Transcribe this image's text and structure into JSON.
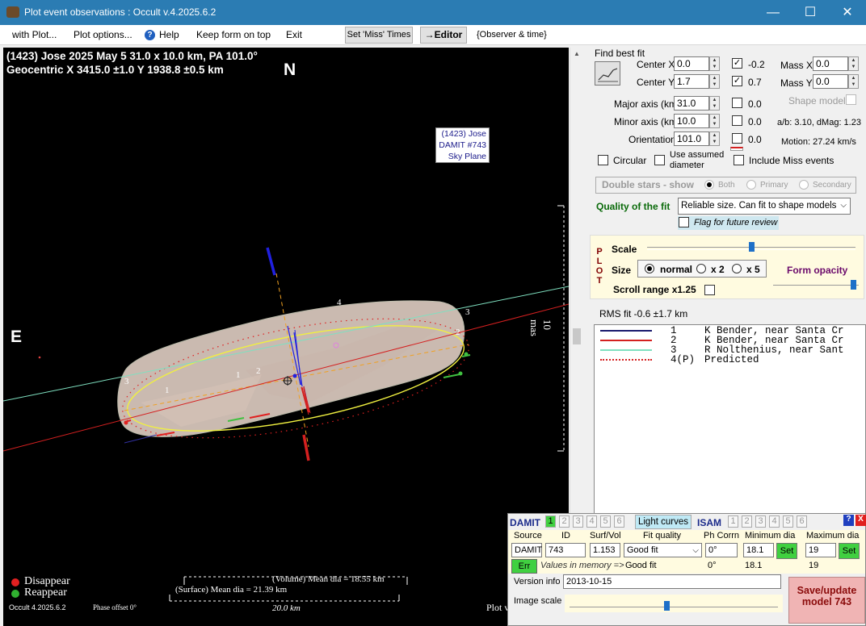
{
  "window": {
    "title": "Plot event observations : Occult v.4.2025.6.2",
    "minimize_glyph": "—",
    "maximize_glyph": "☐",
    "close_glyph": "✕"
  },
  "menu": {
    "with_plot": "with Plot...",
    "plot_options": "Plot options...",
    "help": "Help",
    "keep_on_top": "Keep form on top",
    "exit": "Exit",
    "set_miss_times": "Set 'Miss' Times",
    "editor": "→Editor",
    "observer_time": "{Observer & time}"
  },
  "plot": {
    "header_line1": "(1423) Jose  2025 May 5  31.0 x 10.0 km, PA 101.0°",
    "header_line2": "Geocentric  X  3415.0 ±1.0  Y 1938.8 ±0.5 km",
    "north": "N",
    "east": "E",
    "label_box": [
      "(1423) Jose",
      "DAMIT #743",
      "Sky Plane"
    ],
    "scale_label": "10 mas",
    "chord_labels": [
      "1",
      "1",
      "2",
      "2",
      "3",
      "3",
      "4"
    ],
    "legend_disappear": "Disappear",
    "legend_reappear": "Reappear",
    "volume_dia": "(Volume) Mean dia = 18.55 km",
    "surface_dia": "(Surface) Mean dia = 21.39 km",
    "km_scale": "20.0 km",
    "version": "Occult 4.2025.6.2",
    "phase_offset": "Phase offset 0°",
    "plot_cut": "Plot v"
  },
  "fit": {
    "find_best_fit": "Find best fit",
    "center_x_label": "Center X",
    "center_x": "0.0",
    "center_y_label": "Center Y",
    "center_y": "1.7",
    "center_x_check_val": "-0.2",
    "center_y_check_val": "0.7",
    "mass_x_label": "Mass X",
    "mass_x": "0.0",
    "mass_y_label": "Mass Y",
    "mass_y": "0.0",
    "major_label": "Major axis (km)",
    "major": "31.0",
    "major_check_val": "0.0",
    "minor_label": "Minor axis (km)",
    "minor": "10.0",
    "minor_check_val": "0.0",
    "orient_label": "Orientation",
    "orient": "101.0",
    "orient_check_val": "0.0",
    "shape_model": "Shape model",
    "ab_dmag": "a/b: 3.10, dMag: 1.23",
    "motion": "Motion: 27.24 km/s",
    "circular": "Circular",
    "use_assumed": "Use assumed",
    "diameter": "diameter",
    "include_miss": "Include Miss events",
    "double_stars": "Double stars - show",
    "both": "Both",
    "primary": "Primary",
    "secondary": "Secondary",
    "quality_label": "Quality of the fit",
    "quality_value": "Reliable size. Can fit to shape models",
    "flag_review": "Flag for future review"
  },
  "plotpanel": {
    "plot_vertical": [
      "P",
      "L",
      "O",
      "T"
    ],
    "scale": "Scale",
    "size": "Size",
    "normal": "normal",
    "x2": "x 2",
    "x5": "x 5",
    "form_opacity": "Form opacity",
    "scroll_range": "Scroll range x1.25"
  },
  "rms": "RMS fit -0.6 ±1.7 km",
  "observers": [
    {
      "num": "1",
      "name": "K Bender, near Santa Cr",
      "color": "#1a1a6e",
      "style": "solid"
    },
    {
      "num": "2",
      "name": "K Bender, near Santa Cr",
      "color": "#d42020",
      "style": "solid"
    },
    {
      "num": "3",
      "name": "R Nolthenius, near Sant",
      "color": "#7fe0c0",
      "style": "solid"
    },
    {
      "num": "4(P)",
      "name": "Predicted",
      "color": "#d42020",
      "style": "dots"
    }
  ],
  "damit": {
    "damit_label": "DAMIT",
    "tabs": [
      "1",
      "2",
      "3",
      "4",
      "5",
      "6"
    ],
    "light_curves": "Light curves",
    "isam_label": "ISAM",
    "isam_tabs": [
      "1",
      "2",
      "3",
      "4",
      "5",
      "6"
    ],
    "help_glyph": "?",
    "close_glyph": "X",
    "source_label": "Source",
    "id_label": "ID",
    "surf_vol_label": "Surf/Vol",
    "fit_quality_label": "Fit quality",
    "ph_corrn_label": "Ph Corrn",
    "min_dia_label": "Minimum dia",
    "max_dia_label": "Maximum dia",
    "source": "DAMIT",
    "id": "743",
    "surf_vol": "1.153",
    "fit_quality": "Good fit",
    "ph_corrn": "0°",
    "min_dia": "18.1",
    "max_dia": "19",
    "set": "Set",
    "err": "Err",
    "values_in_memory": "Values in memory =>",
    "mem_fit": "Good fit",
    "mem_ph": "0°",
    "mem_min": "18.1",
    "mem_max": "19",
    "version_info_label": "Version info",
    "version_info": "2013-10-15",
    "image_scale_label": "Image scale",
    "save_update": "Save/update",
    "model_num": "model 743"
  },
  "colors": {
    "titlebar": "#2b7cb3",
    "ellipse": "#f0f040",
    "chord_green": "#7fe0c0",
    "chord_red": "#e02020",
    "shape_fill": "#e6d4c8",
    "save_btn": "#f0b4b4",
    "set_btn": "#40d040"
  }
}
